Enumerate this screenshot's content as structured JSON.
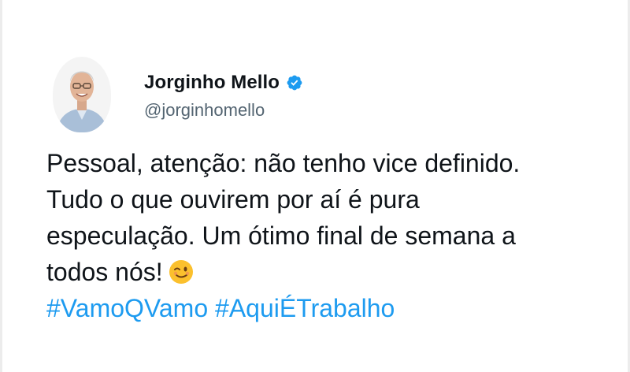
{
  "author": {
    "display_name": "Jorginho Mello",
    "handle": "@jorginhomello",
    "verified": true,
    "verified_color": "#1d9bf0"
  },
  "tweet": {
    "lines": [
      "Pessoal, atenção: não tenho vice definido.",
      "Tudo o que ouvirem por aí é pura",
      "especulação. Um ótimo final de semana a",
      "todos nós!"
    ],
    "emoji": "winking-face-icon",
    "hashtags": [
      "#VamoQVamo",
      "#AquiÉTrabalho"
    ]
  },
  "colors": {
    "text": "#0f1419",
    "secondary_text": "#536471",
    "link": "#1d9bf0"
  }
}
